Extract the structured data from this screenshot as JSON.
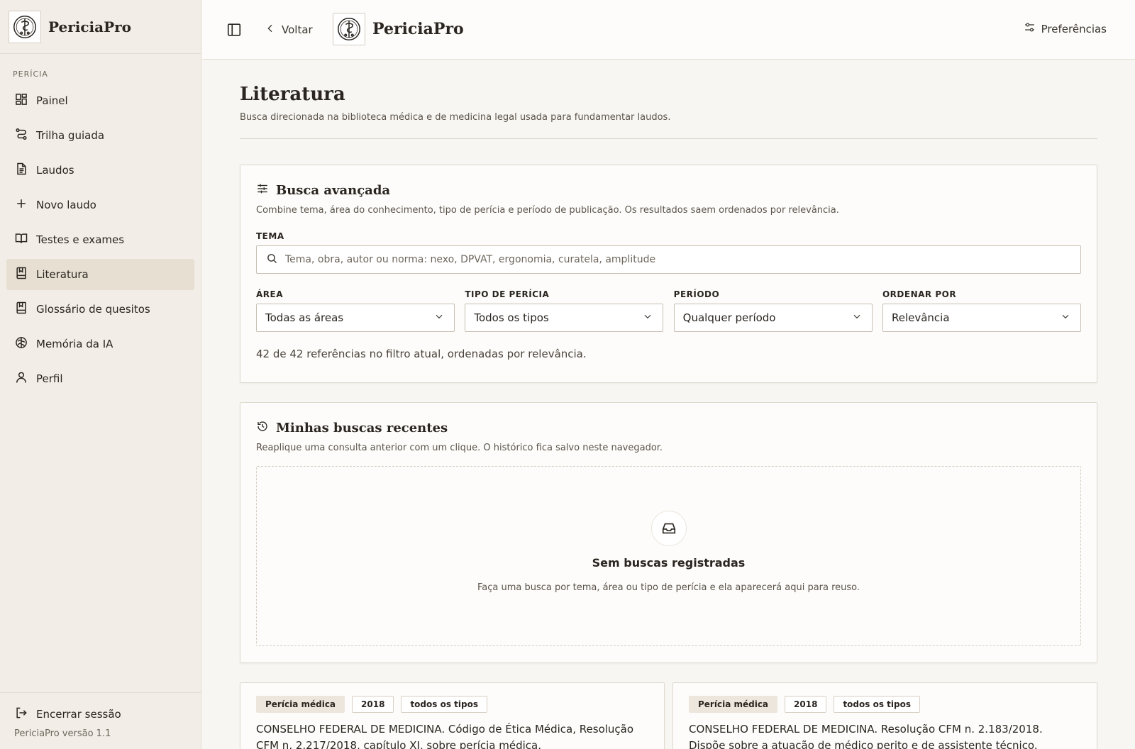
{
  "brand": {
    "name": "PericiaPro"
  },
  "sidebar": {
    "section": "PERÍCIA",
    "items": [
      {
        "label": "Painel",
        "icon": "dashboard-icon"
      },
      {
        "label": "Trilha guiada",
        "icon": "route-icon"
      },
      {
        "label": "Laudos",
        "icon": "document-icon"
      },
      {
        "label": "Novo laudo",
        "icon": "plus-icon"
      },
      {
        "label": "Testes e exames",
        "icon": "book-open-icon"
      },
      {
        "label": "Literatura",
        "icon": "book-bookmark-icon",
        "active": true
      },
      {
        "label": "Glossário de quesitos",
        "icon": "book-bookmark-icon"
      },
      {
        "label": "Memória da IA",
        "icon": "brain-icon"
      },
      {
        "label": "Perfil",
        "icon": "user-icon"
      }
    ],
    "logout": "Encerrar sessão",
    "version": "PericiaPro versão 1.1"
  },
  "topbar": {
    "back": "Voltar",
    "preferences": "Preferências"
  },
  "page": {
    "title": "Literatura",
    "subtitle": "Busca direcionada na biblioteca médica e de medicina legal usada para fundamentar laudos."
  },
  "advanced": {
    "title": "Busca avançada",
    "desc": "Combine tema, área do conhecimento, tipo de perícia e período de publicação. Os resultados saem ordenados por relevância.",
    "tema_label": "TEMA",
    "tema_placeholder": "Tema, obra, autor ou norma: nexo, DPVAT, ergonomia, curatela, amplitude",
    "filters": [
      {
        "label": "ÁREA",
        "value": "Todas as áreas"
      },
      {
        "label": "TIPO DE PERÍCIA",
        "value": "Todos os tipos"
      },
      {
        "label": "PERÍODO",
        "value": "Qualquer período"
      },
      {
        "label": "ORDENAR POR",
        "value": "Relevância"
      }
    ],
    "count": "42 de 42 referências no filtro atual, ordenadas por relevância."
  },
  "recent": {
    "title": "Minhas buscas recentes",
    "desc": "Reaplique uma consulta anterior com um clique. O histórico fica salvo neste navegador.",
    "empty_title": "Sem buscas registradas",
    "empty_desc": "Faça uma busca por tema, área ou tipo de perícia e ela aparecerá aqui para reuso."
  },
  "results": [
    {
      "tags": [
        "Perícia médica",
        "2018",
        "todos os tipos"
      ],
      "text": "CONSELHO FEDERAL DE MEDICINA. Código de Ética Médica, Resolução CFM n. 2.217/2018, capítulo XI, sobre perícia médica."
    },
    {
      "tags": [
        "Perícia médica",
        "2018",
        "todos os tipos"
      ],
      "text": "CONSELHO FEDERAL DE MEDICINA. Resolução CFM n. 2.183/2018. Dispõe sobre a atuação de médico perito e de assistente técnico."
    }
  ],
  "colors": {
    "accent_bg": "#e6dfd2",
    "sidebar_bg": "#f2eee7",
    "page_bg": "#f8f6f2"
  }
}
